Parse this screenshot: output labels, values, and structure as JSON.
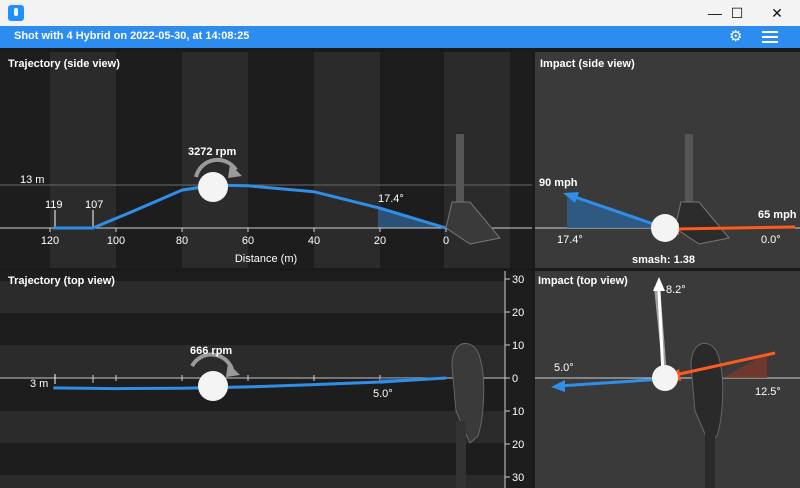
{
  "window": {
    "title": "",
    "minimize": "—",
    "maximize": "☐",
    "close": "✕"
  },
  "toolbar": {
    "title": "Shot with 4 Hybrid on 2022-05-30, at 14:08:25"
  },
  "icons": {
    "app": "app-icon",
    "settings": "gear-icon",
    "menu": "hamburger-menu-icon"
  },
  "side_trajectory": {
    "title": "Trajectory (side view)",
    "spin": "3272 rpm",
    "height": "13 m",
    "carry": "119",
    "total": "107",
    "launch_angle": "17.4°",
    "xlabel": "Distance (m)",
    "ticks": [
      "120",
      "100",
      "80",
      "60",
      "40",
      "20",
      "0"
    ]
  },
  "side_impact": {
    "title": "Impact (side view)",
    "ball_speed": "90 mph",
    "club_speed": "65 mph",
    "launch_angle": "17.4°",
    "attack_angle": "0.0°",
    "smash": "smash: 1.38"
  },
  "top_trajectory": {
    "title": "Trajectory (top view)",
    "spin": "666 rpm",
    "offline": "3 m",
    "direction": "5.0°",
    "ticks": [
      "30",
      "20",
      "10",
      "0",
      "10",
      "20",
      "30"
    ]
  },
  "top_impact": {
    "title": "Impact (top view)",
    "spin_axis": "8.2°",
    "direction": "5.0°",
    "face_angle": "12.5°"
  },
  "colors": {
    "accent": "#2d8cf0",
    "ball_path": "#2f8fe8",
    "club_path": "#ff5a1f"
  },
  "chart_data": [
    {
      "type": "line",
      "name": "side-trajectory",
      "x": [
        119,
        107,
        95,
        80,
        70,
        60,
        40,
        20,
        0
      ],
      "y": [
        0,
        0,
        5,
        11.5,
        13,
        12.8,
        11,
        6,
        0
      ]
    },
    {
      "type": "line",
      "name": "top-trajectory",
      "x": [
        119,
        100,
        80,
        60,
        40,
        20,
        0
      ],
      "y": [
        -3,
        -3.2,
        -3.1,
        -2.7,
        -2,
        -1.2,
        0
      ]
    }
  ]
}
